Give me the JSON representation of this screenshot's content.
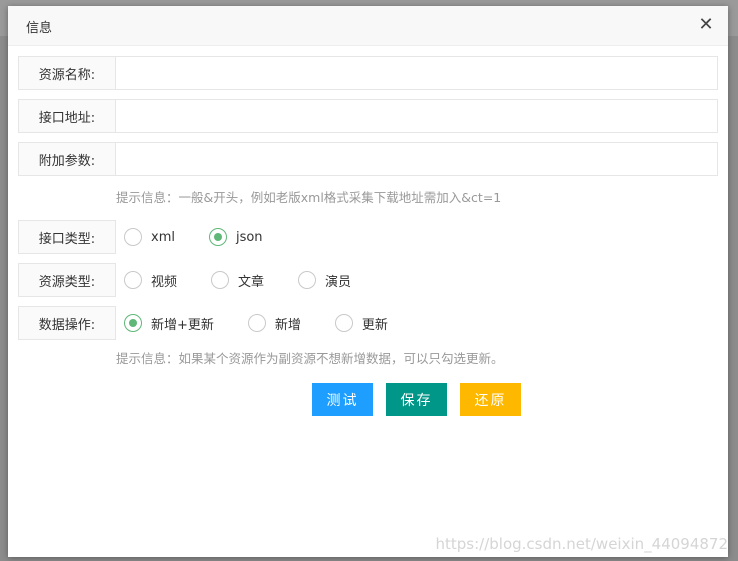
{
  "dialog": {
    "title": "信息",
    "close": "✕"
  },
  "fields": {
    "resource_name": {
      "label": "资源名称:",
      "value": ""
    },
    "api_url": {
      "label": "接口地址:",
      "value": ""
    },
    "extra_params": {
      "label": "附加参数:",
      "value": ""
    }
  },
  "hint1": "提示信息：一般&开头，例如老版xml格式采集下载地址需加入&ct=1",
  "api_type": {
    "label": "接口类型:",
    "options": [
      "xml",
      "json"
    ],
    "selected": "json"
  },
  "resource_type": {
    "label": "资源类型:",
    "options": [
      "视频",
      "文章",
      "演员"
    ],
    "selected": ""
  },
  "data_op": {
    "label": "数据操作:",
    "options": [
      "新增+更新",
      "新增",
      "更新"
    ],
    "selected": "新增+更新"
  },
  "hint2": "提示信息：如果某个资源作为副资源不想新增数据，可以只勾选更新。",
  "buttons": {
    "test": "测试",
    "save": "保存",
    "reset": "还原"
  },
  "watermark": "https://blog.csdn.net/weixin_44094872",
  "colors": {
    "test": "#1e9fff",
    "save": "#009688",
    "reset": "#ffb800",
    "radio_checked": "#5fb878"
  }
}
